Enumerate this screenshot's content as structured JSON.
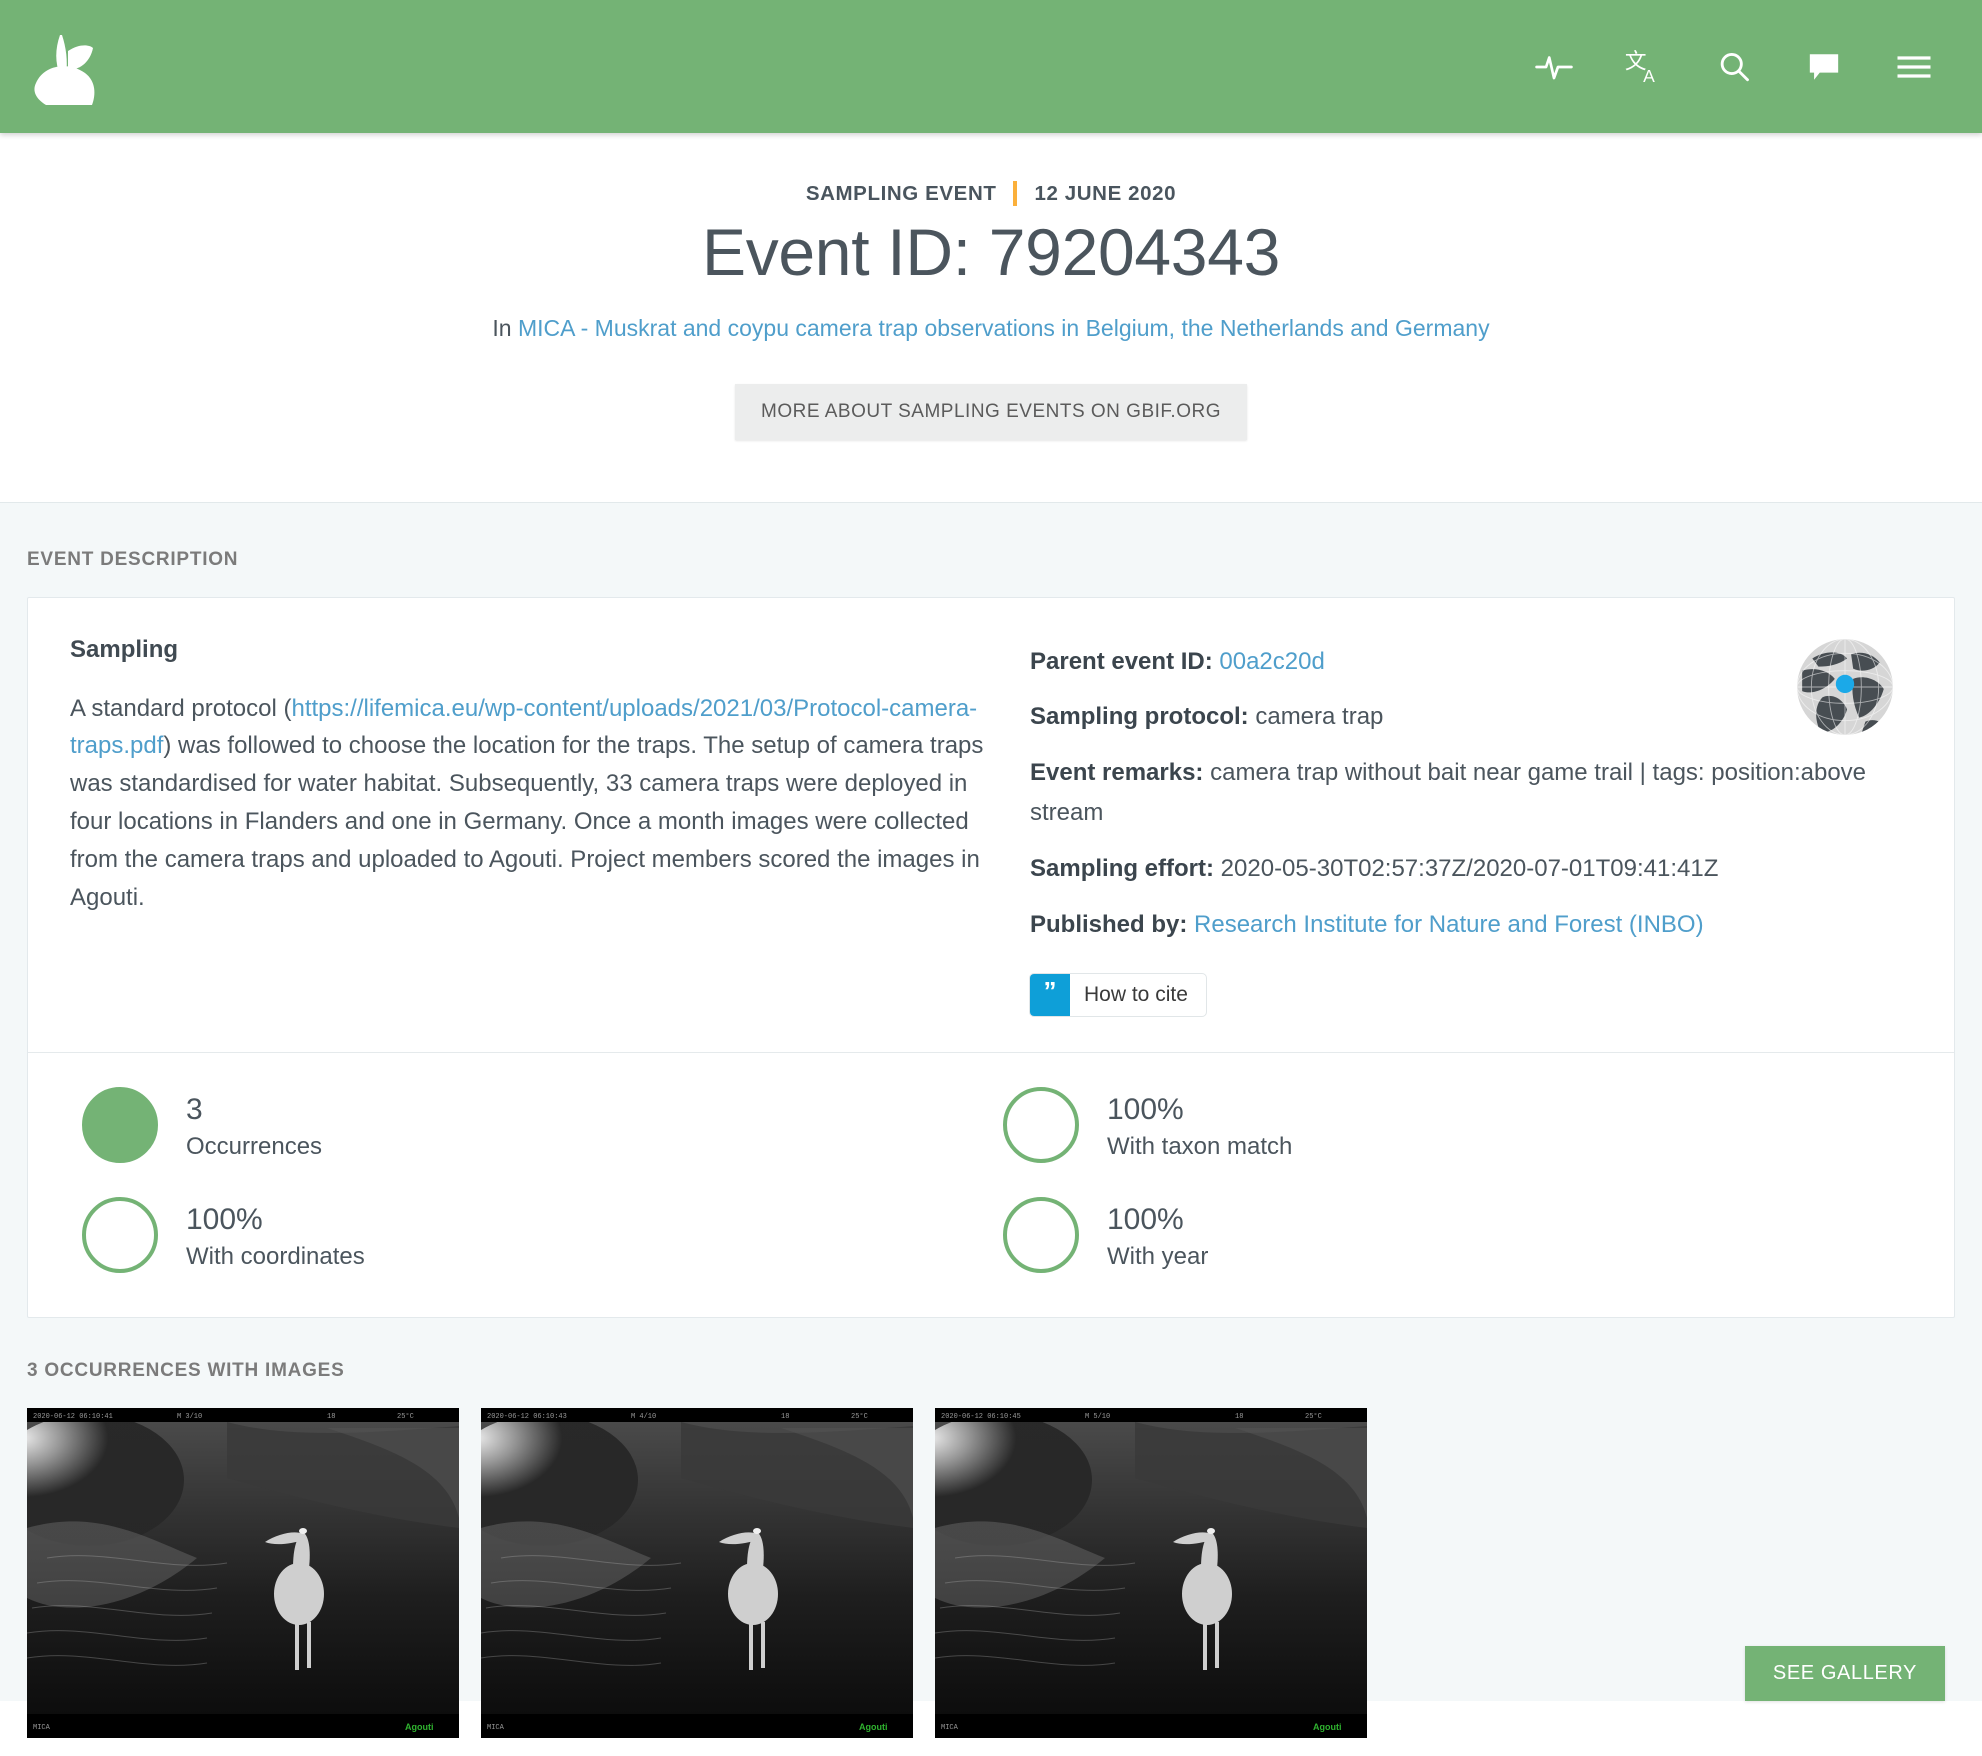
{
  "header": {
    "logo_name": "gbif-leaf-logo",
    "icons": [
      {
        "name": "activity-pulse-icon",
        "title": "Activity"
      },
      {
        "name": "translate-icon",
        "title": "Language"
      },
      {
        "name": "search-icon",
        "title": "Search"
      },
      {
        "name": "feedback-chat-icon",
        "title": "Feedback"
      },
      {
        "name": "hamburger-menu-icon",
        "title": "Menu"
      }
    ],
    "brand_color": "#74b375"
  },
  "title_block": {
    "kicker": "SAMPLING EVENT",
    "separator_color": "#fbb03b",
    "date": "12 JUNE 2020",
    "heading": "Event ID: 79204343",
    "in_prefix": "In",
    "dataset_link": "MICA - Muskrat and coypu camera trap observations in Belgium, the Netherlands and Germany",
    "more_button": "MORE ABOUT SAMPLING EVENTS ON GBIF.ORG"
  },
  "event_description": {
    "section_label": "EVENT DESCRIPTION",
    "sampling_heading": "Sampling",
    "sampling_text_before": "A standard protocol (",
    "sampling_link": "https://lifemica.eu/wp-content/uploads/2021/03/Protocol-camera-traps.pdf",
    "sampling_text_after": ") was followed to choose the location for the traps. The setup of camera traps was standardised for water habitat. Subsequently, 33 camera traps were deployed in four locations in Flanders and one in Germany. Once a month images were collected from the camera traps and uploaded to Agouti. Project members scored the images in Agouti.",
    "meta": {
      "parent_event_label": "Parent event ID:",
      "parent_event_value": "00a2c20d",
      "protocol_label": "Sampling protocol:",
      "protocol_value": "camera trap",
      "remarks_label": "Event remarks:",
      "remarks_value": "camera trap without bait near game trail | tags: position:above stream",
      "effort_label": "Sampling effort:",
      "effort_value": "2020-05-30T02:57:37Z/2020-07-01T09:41:41Z",
      "published_label": "Published by:",
      "published_value": "Research Institute for Nature and Forest (INBO)"
    },
    "cite_button": {
      "glyph": "”",
      "label": "How to cite",
      "accent_color": "#0e9fd8"
    },
    "globe_name": "location-globe-thumbnail",
    "globe_marker_color": "#1ba9e8"
  },
  "stats": [
    {
      "value": "3",
      "label": "Occurrences",
      "filled": true
    },
    {
      "value": "100%",
      "label": "With taxon match",
      "filled": false
    },
    {
      "value": "100%",
      "label": "With coordinates",
      "filled": false
    },
    {
      "value": "100%",
      "label": "With year",
      "filled": false
    }
  ],
  "gallery": {
    "section_label": "3 OCCURRENCES WITH IMAGES",
    "see_gallery_button": "SEE GALLERY",
    "thumbnails": [
      {
        "name": "camera-trap-thumbnail-1",
        "alt": "grey heron in stream at night"
      },
      {
        "name": "camera-trap-thumbnail-2",
        "alt": "grey heron in stream at night"
      },
      {
        "name": "camera-trap-thumbnail-3",
        "alt": "grey heron in stream at night"
      }
    ]
  }
}
